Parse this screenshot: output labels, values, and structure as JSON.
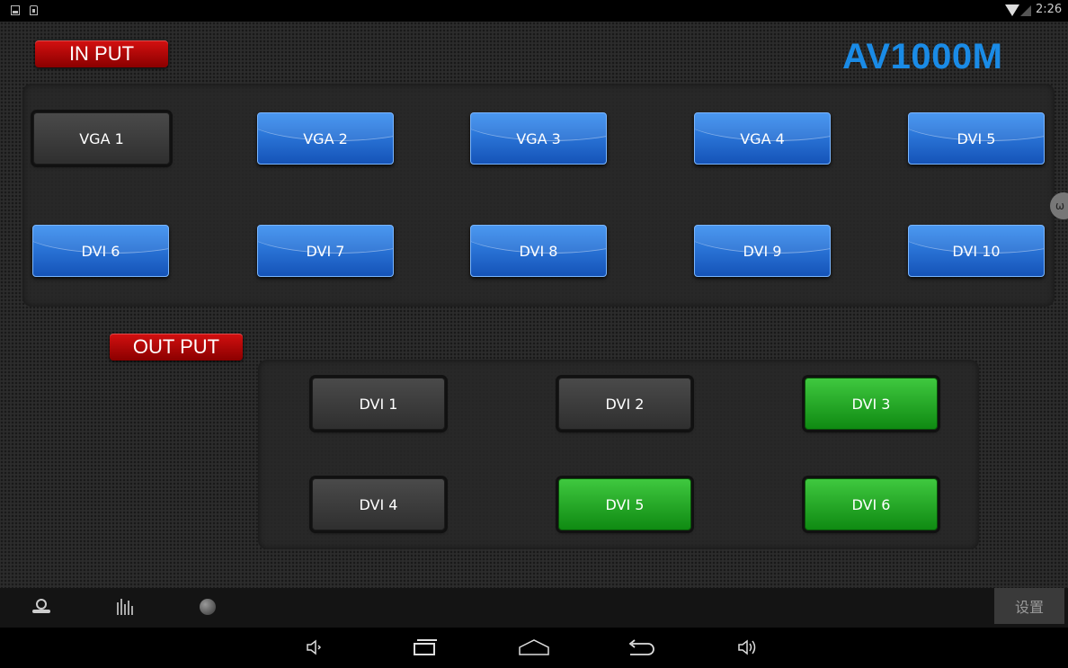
{
  "status_bar": {
    "time": "2:26"
  },
  "input": {
    "label": "IN PUT",
    "buttons": [
      {
        "label": "VGA 1",
        "state": "gray"
      },
      {
        "label": "VGA 2",
        "state": "blue"
      },
      {
        "label": "VGA 3",
        "state": "blue"
      },
      {
        "label": "VGA 4",
        "state": "blue"
      },
      {
        "label": "DVI 5",
        "state": "blue"
      },
      {
        "label": "DVI 6",
        "state": "blue"
      },
      {
        "label": "DVI 7",
        "state": "blue"
      },
      {
        "label": "DVI 8",
        "state": "blue"
      },
      {
        "label": "DVI 9",
        "state": "blue"
      },
      {
        "label": "DVI 10",
        "state": "blue"
      }
    ]
  },
  "brand": "AV1000M",
  "output": {
    "label": "OUT PUT",
    "buttons": [
      {
        "label": "DVI 1",
        "state": "gray"
      },
      {
        "label": "DVI 2",
        "state": "gray"
      },
      {
        "label": "DVI 3",
        "state": "green"
      },
      {
        "label": "DVI 4",
        "state": "gray"
      },
      {
        "label": "DVI 5",
        "state": "green"
      },
      {
        "label": "DVI 6",
        "state": "green"
      }
    ]
  },
  "toolbar": {
    "icons": [
      "film-reel-icon",
      "equalizer-icon",
      "globe-icon"
    ],
    "settings_label": "设置"
  },
  "navbar": {
    "icons": [
      "volume-down-icon",
      "recent-apps-icon",
      "home-icon",
      "back-icon",
      "volume-up-icon"
    ]
  },
  "colors": {
    "brand": "#1a8be6",
    "selected_input": "#1553b8",
    "selected_output": "#0f8a12",
    "tag_red": "#d41010"
  }
}
